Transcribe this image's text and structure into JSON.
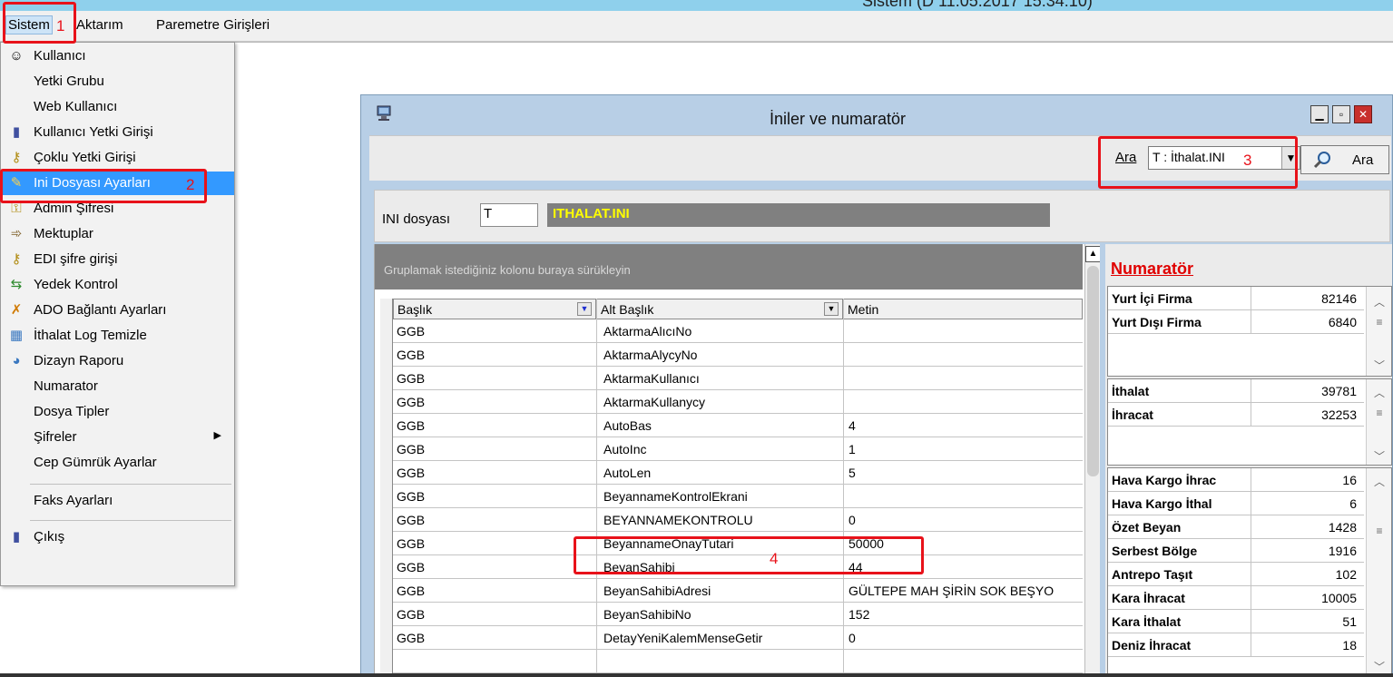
{
  "window_title": "Sistem (D 11.05.2017 15:34:10)",
  "menubar": {
    "items": [
      {
        "label": "Sistem",
        "selected": true
      },
      {
        "label": "Aktarım"
      },
      {
        "label": "Paremetre Girişleri"
      }
    ]
  },
  "sistem_menu": {
    "items": [
      {
        "label": "Kullanıcı",
        "icon": "user-icon"
      },
      {
        "label": "Yetki Grubu"
      },
      {
        "label": "Web Kullanıcı"
      },
      {
        "label": "Kullanıcı Yetki Girişi",
        "icon": "door-icon"
      },
      {
        "label": "Çoklu Yetki Girişi",
        "icon": "keys-icon"
      },
      {
        "label": "Ini Dosyası Ayarları",
        "icon": "settings-file-icon",
        "highlighted": true
      },
      {
        "label": "Admin Şifresi",
        "icon": "key-icon"
      },
      {
        "label": "Mektuplar",
        "icon": "letter-arrow-icon"
      },
      {
        "label": "EDI şifre girişi",
        "icon": "keys-icon"
      },
      {
        "label": "Yedek Kontrol",
        "icon": "backup-icon"
      },
      {
        "label": "ADO Bağlantı Ayarları",
        "icon": "connection-icon"
      },
      {
        "label": "İthalat Log Temizle",
        "icon": "clean-log-icon"
      },
      {
        "label": "Dizayn Raporu",
        "icon": "report-icon"
      },
      {
        "label": "Numarator"
      },
      {
        "label": "Dosya Tipler"
      },
      {
        "label": "Şifreler",
        "submenu": true
      },
      {
        "label": "Cep Gümrük Ayarlar"
      },
      {
        "label": "Faks Ayarları"
      },
      {
        "label": "Çıkış",
        "icon": "door-icon"
      }
    ]
  },
  "dialog": {
    "title": "İniler ve numaratör",
    "search": {
      "label": "Ara",
      "selected": "T : İthalat.INI",
      "button_label": "Ara"
    },
    "ini_file": {
      "label": "INI dosyası",
      "code": "T",
      "name": "ITHALAT.INI"
    },
    "grid": {
      "group_panel_text": "Gruplamak istediğiniz kolonu buraya sürükleyin",
      "columns": [
        "Başlık",
        "Alt Başlık",
        "Metin"
      ],
      "rows": [
        {
          "baslik": "GGB",
          "alt": "AktarmaAlıcıNo",
          "metin": ""
        },
        {
          "baslik": "GGB",
          "alt": "AktarmaAlycyNo",
          "metin": ""
        },
        {
          "baslik": "GGB",
          "alt": "AktarmaKullanıcı",
          "metin": ""
        },
        {
          "baslik": "GGB",
          "alt": "AktarmaKullanycy",
          "metin": ""
        },
        {
          "baslik": "GGB",
          "alt": "AutoBas",
          "metin": "4"
        },
        {
          "baslik": "GGB",
          "alt": "AutoInc",
          "metin": "1"
        },
        {
          "baslik": "GGB",
          "alt": "AutoLen",
          "metin": "5"
        },
        {
          "baslik": "GGB",
          "alt": "BeyannameKontrolEkrani",
          "metin": ""
        },
        {
          "baslik": "GGB",
          "alt": "BEYANNAMEKONTROLU",
          "metin": "0"
        },
        {
          "baslik": "GGB",
          "alt": "BeyannameOnayTutari",
          "metin": "50000"
        },
        {
          "baslik": "GGB",
          "alt": "BeyanSahibi",
          "metin": "44"
        },
        {
          "baslik": "GGB",
          "alt": "BeyanSahibiAdresi",
          "metin": "GÜLTEPE MAH ŞİRİN SOK BEŞYO"
        },
        {
          "baslik": "GGB",
          "alt": "BeyanSahibiNo",
          "metin": "152"
        },
        {
          "baslik": "GGB",
          "alt": "DetayYeniKalemMenseGetir",
          "metin": "0"
        }
      ]
    },
    "numarator": {
      "title": "Numaratör",
      "group1": [
        {
          "label": "Yurt İçi Firma",
          "value": "82146"
        },
        {
          "label": "Yurt Dışı Firma",
          "value": "6840"
        }
      ],
      "group2": [
        {
          "label": "İthalat",
          "value": "39781"
        },
        {
          "label": "İhracat",
          "value": "32253"
        }
      ],
      "group3": [
        {
          "label": "Hava Kargo İhrac",
          "value": "16"
        },
        {
          "label": "Hava Kargo İthal",
          "value": "6"
        },
        {
          "label": "Özet Beyan",
          "value": "1428"
        },
        {
          "label": "Serbest Bölge",
          "value": "1916"
        },
        {
          "label": "Antrepo Taşıt",
          "value": "102"
        },
        {
          "label": "Kara İhracat",
          "value": "10005"
        },
        {
          "label": "Kara İthalat",
          "value": "51"
        },
        {
          "label": "Deniz İhracat",
          "value": "18"
        }
      ]
    }
  },
  "annotations": [
    "1",
    "2",
    "3",
    "4"
  ],
  "colors": {
    "highlight": "#3399ff",
    "annotation": "#e8121a",
    "numarator_title": "#e00000",
    "ini_name": "#ffff00"
  }
}
